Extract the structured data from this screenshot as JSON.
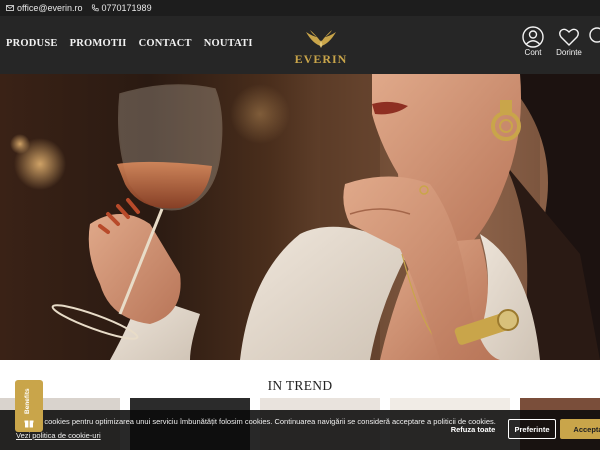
{
  "topbar": {
    "email": "office@everin.ro",
    "phone": "0770171989"
  },
  "nav": {
    "items": [
      "PRODUSE",
      "PROMOTII",
      "CONTACT",
      "NOUTATI"
    ]
  },
  "brand": {
    "name": "EVERIN",
    "accent_color": "#c9a54a"
  },
  "header_icons": {
    "account_label": "Cont",
    "wishlist_label": "Dorinte"
  },
  "section": {
    "trend_title": "IN TREND"
  },
  "cookie": {
    "text": "Folosim cookies pentru optimizarea unui serviciu îmbunătățit folosim cookies. Continuarea navigării se consideră acceptare a politicii de cookies.",
    "policy_link": "Vezi politica de cookie-uri",
    "refuse_label": "Refuza toate",
    "preferences_label": "Preferinte",
    "accept_label": "Accepta"
  },
  "benefits": {
    "label": "Benefits"
  }
}
